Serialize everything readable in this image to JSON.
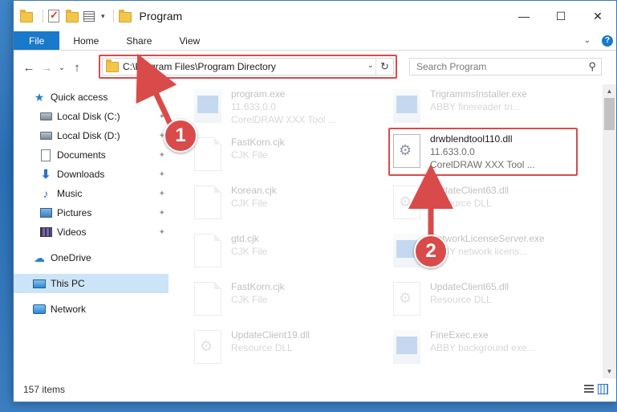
{
  "window": {
    "title": "Program",
    "controls": {
      "minimize": "—",
      "maximize": "☐",
      "close": "✕"
    }
  },
  "ribbon": {
    "tabs": [
      {
        "label": "File"
      },
      {
        "label": "Home"
      },
      {
        "label": "Share"
      },
      {
        "label": "View"
      }
    ]
  },
  "addressbar": {
    "path": "C:\\Program Files\\Program Directory",
    "search_placeholder": "Search Program"
  },
  "sidebar": {
    "items": [
      {
        "label": "Quick access",
        "icon": "star-icon"
      },
      {
        "label": "Local Disk (C:)",
        "icon": "disk-icon",
        "pinned": true
      },
      {
        "label": "Local Disk (D:)",
        "icon": "disk-icon",
        "pinned": true
      },
      {
        "label": "Documents",
        "icon": "documents-icon",
        "pinned": true
      },
      {
        "label": "Downloads",
        "icon": "downloads-icon",
        "pinned": true
      },
      {
        "label": "Music",
        "icon": "music-icon",
        "pinned": true
      },
      {
        "label": "Pictures",
        "icon": "pictures-icon",
        "pinned": true
      },
      {
        "label": "Videos",
        "icon": "videos-icon",
        "pinned": true
      },
      {
        "label": "OneDrive",
        "icon": "onedrive-icon"
      },
      {
        "label": "This PC",
        "icon": "this-pc-icon",
        "selected": true
      },
      {
        "label": "Network",
        "icon": "network-icon"
      }
    ]
  },
  "files": [
    {
      "name": "program.exe",
      "line2": "11.633.0.0",
      "line3": "CorelDRAW XXX Tool ...",
      "type": "exe"
    },
    {
      "name": "TrigrammsInstaller.exe",
      "line2": "ABBY finereader tri...",
      "type": "exe"
    },
    {
      "name": "FastKorn.cjk",
      "line2": "CJK File",
      "type": "cjk"
    },
    {
      "name": "Korean.cjk",
      "line2": "CJK File",
      "type": "cjk"
    },
    {
      "name": "UpdateClient63.dll",
      "line2": "Resource DLL",
      "type": "dll"
    },
    {
      "name": "gtd.cjk",
      "line2": "CJK File",
      "type": "cjk"
    },
    {
      "name": "NetworkLicenseServer.exe",
      "line2": "ABBY network licens...",
      "type": "exe"
    },
    {
      "name": "FastKorn.cjk",
      "line2": "CJK File",
      "type": "cjk"
    },
    {
      "name": "UpdateClient65.dll",
      "line2": "Resource DLL",
      "type": "dll"
    },
    {
      "name": "UpdateClient19.dll",
      "line2": "Resource DLL",
      "type": "dll"
    },
    {
      "name": "FineExec.exe",
      "line2": "ABBY background exe...",
      "type": "exe"
    }
  ],
  "highlighted_file": {
    "name": "drwblendtool110.dll",
    "line2": "11.633.0.0",
    "line3": "CorelDRAW XXX Tool ..."
  },
  "status": {
    "item_count": "157 items"
  },
  "annotations": {
    "step1": "1",
    "step2": "2",
    "color": "#d94b4b"
  }
}
